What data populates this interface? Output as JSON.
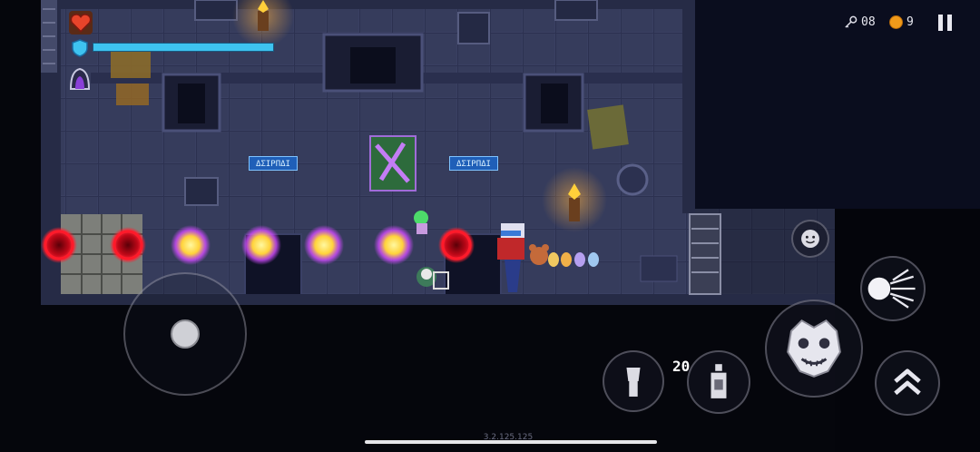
{
  "hud": {
    "keys_icon": "key-icon",
    "keys_count": "08",
    "coins_icon": "coin-icon",
    "coins_count": "9",
    "health_icon": "heart-icon",
    "shield_icon": "shield-icon",
    "shield_fraction": 1.0,
    "skill_icon": "hood-icon",
    "pause_icon": "pause-icon"
  },
  "room": {
    "wall_plate_left": "ΔΣΙΡΠΔΙ",
    "wall_plate_right": "ΔΣΙΡΠΔΙ"
  },
  "weapon": {
    "ammo": "20"
  },
  "controls": {
    "emote_icon": "smiley-icon",
    "dash_icon": "comet-icon",
    "attack_icon": "lion-mask-icon",
    "swap_icon": "chevrons-up-icon",
    "weapon_slot_icon": "flashlight-icon",
    "item_slot_icon": "bottle-icon",
    "joystick_icon": "joystick-icon"
  },
  "build": {
    "version": "3.2.125.125"
  },
  "colors": {
    "shield_bar": "#3ec3f0",
    "orb_yellow": "#ffe34a",
    "orb_red": "#d01020",
    "floor": "#3a4062",
    "wall": "#262b46"
  }
}
